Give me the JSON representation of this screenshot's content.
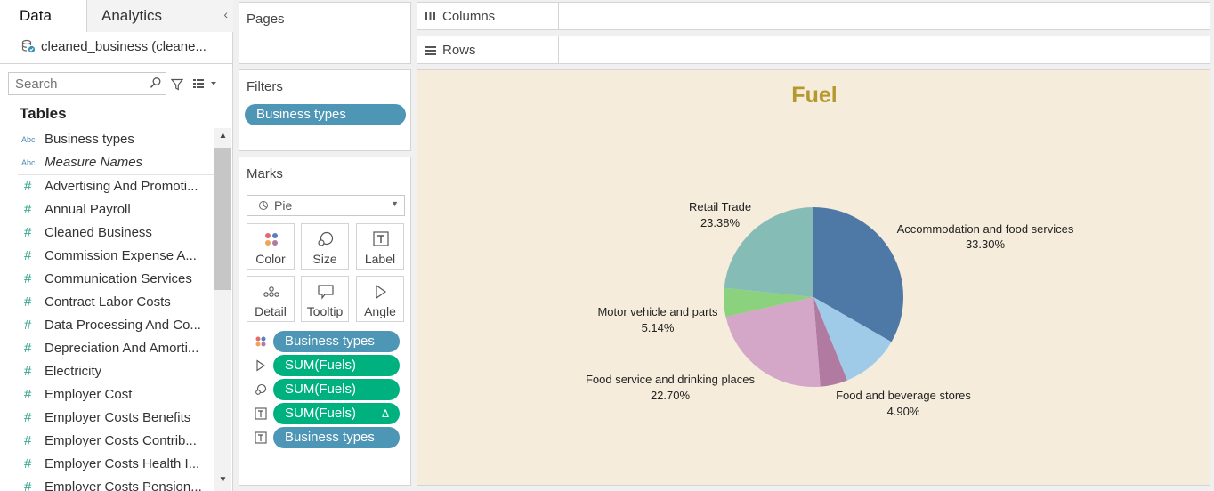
{
  "tabs": {
    "data": "Data",
    "analytics": "Analytics"
  },
  "datasource": "cleaned_business (cleane...",
  "search": {
    "placeholder": "Search"
  },
  "tables_heading": "Tables",
  "fields": [
    {
      "type": "Abc",
      "name": "Business types"
    },
    {
      "type": "Abc",
      "name": "Measure Names"
    },
    {
      "type": "#",
      "name": "Advertising And Promoti..."
    },
    {
      "type": "#",
      "name": "Annual Payroll"
    },
    {
      "type": "#",
      "name": "Cleaned Business"
    },
    {
      "type": "#",
      "name": "Commission Expense A..."
    },
    {
      "type": "#",
      "name": "Communication Services"
    },
    {
      "type": "#",
      "name": "Contract Labor Costs"
    },
    {
      "type": "#",
      "name": "Data Processing And Co..."
    },
    {
      "type": "#",
      "name": "Depreciation And Amorti..."
    },
    {
      "type": "#",
      "name": "Electricity"
    },
    {
      "type": "#",
      "name": "Employer Cost"
    },
    {
      "type": "#",
      "name": "Employer Costs Benefits"
    },
    {
      "type": "#",
      "name": "Employer Costs Contrib..."
    },
    {
      "type": "#",
      "name": "Employer Costs Health I..."
    },
    {
      "type": "#",
      "name": "Employer Costs Pension..."
    }
  ],
  "shelves": {
    "pages": "Pages",
    "filters": "Filters",
    "marks": "Marks",
    "columns": "Columns",
    "rows": "Rows"
  },
  "filter_pill": "Business types",
  "mark_type": "Pie",
  "mark_buttons": {
    "color": "Color",
    "size": "Size",
    "label": "Label",
    "detail": "Detail",
    "tooltip": "Tooltip",
    "angle": "Angle"
  },
  "mark_fields": [
    "Business types",
    "SUM(Fuels)",
    "SUM(Fuels)",
    "SUM(Fuels)",
    "Business types"
  ],
  "mark_field_delta": "Δ",
  "colors": {
    "background": "#f5ecdb",
    "title": "#b5982e",
    "dimension_pill": "#4d96b6",
    "measure_pill": "#00b180"
  },
  "chart_data": {
    "type": "pie",
    "title": "Fuel",
    "slices": [
      {
        "label": "Accommodation and food services",
        "value": 33.3,
        "display": "33.30%",
        "color": "#4e79a7"
      },
      {
        "label": "Food and beverage stores",
        "value": 10.58,
        "display": "",
        "color": "#a0cbe8"
      },
      {
        "label": "Food and beverage stores",
        "value": 4.9,
        "display": "4.90%",
        "color": "#b07aa1"
      },
      {
        "label": "Food service and drinking places",
        "value": 22.7,
        "display": "22.70%",
        "color": "#d4a6c8"
      },
      {
        "label": "Motor vehicle and parts",
        "value": 5.14,
        "display": "5.14%",
        "color": "#8cd17d"
      },
      {
        "label": "Retail Trade",
        "value": 23.38,
        "display": "23.38%",
        "color": "#86bcb6"
      }
    ],
    "visible_labels": [
      {
        "name": "Accommodation and food services",
        "pct": "33.30%"
      },
      {
        "name": "Food and beverage stores",
        "pct": "4.90%"
      },
      {
        "name": "Food service and drinking places",
        "pct": "22.70%"
      },
      {
        "name": "Motor vehicle and parts",
        "pct": "5.14%"
      },
      {
        "name": "Retail Trade",
        "pct": "23.38%"
      }
    ]
  }
}
